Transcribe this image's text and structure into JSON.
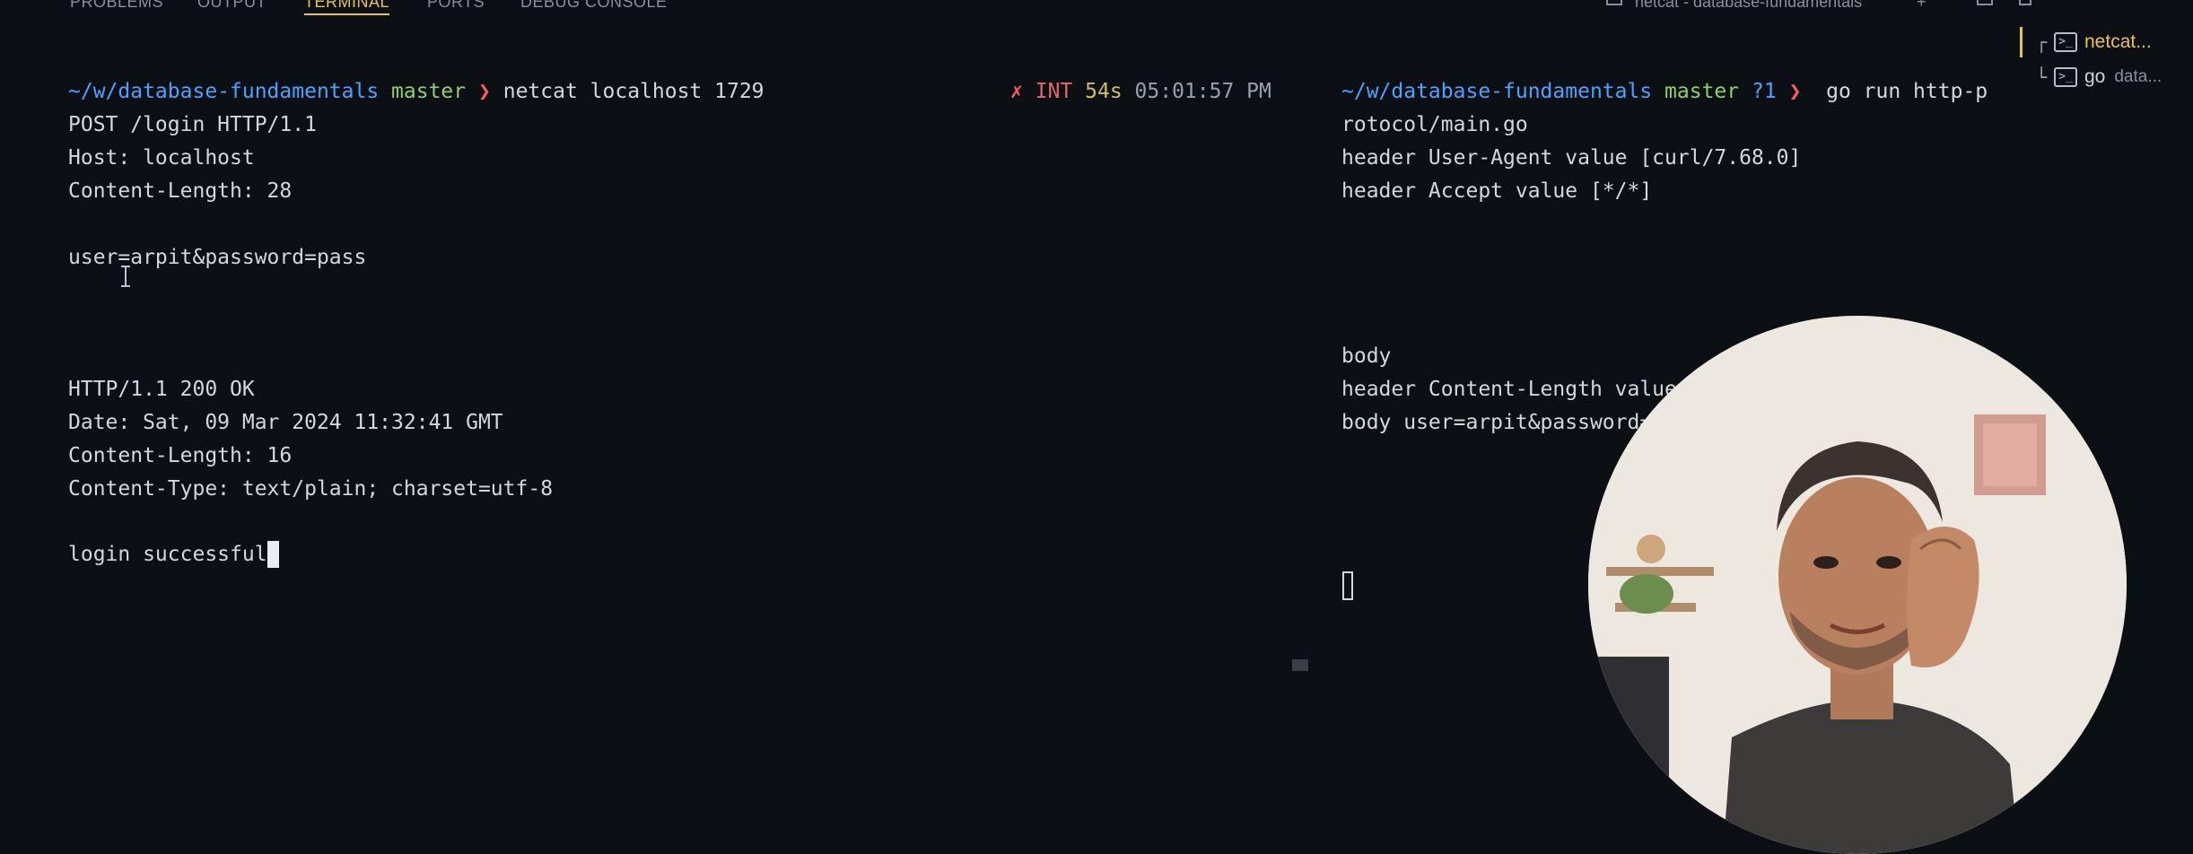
{
  "panel_tabs": [
    "PROBLEMS",
    "OUTPUT",
    "TERMINAL",
    "PORTS",
    "DEBUG CONSOLE"
  ],
  "active_tab": "TERMINAL",
  "top_right": {
    "terminal_title": "netcat - database-fundamentals",
    "plus": "+"
  },
  "terminal_list": [
    {
      "name": "netcat...",
      "sub": "",
      "active": true,
      "icon": "terminal-icon"
    },
    {
      "name": "go",
      "sub": "data...",
      "active": false,
      "icon": "terminal-icon"
    }
  ],
  "left_pane": {
    "prompt": {
      "path_prefix": "~/w/",
      "path_dir": "database-fundamentals",
      "branch": "master",
      "chevron": "❯",
      "command": "netcat localhost 1729",
      "status_x": "✗",
      "status_int": "INT",
      "duration": "54s",
      "time": "05:01:57 PM"
    },
    "request_lines": [
      "POST /login HTTP/1.1",
      "Host: localhost",
      "Content-Length: 28",
      "",
      "user=arpit&password=pass"
    ],
    "response_lines": [
      "HTTP/1.1 200 OK",
      "Date: Sat, 09 Mar 2024 11:32:41 GMT",
      "Content-Length: 16",
      "Content-Type: text/plain; charset=utf-8",
      "",
      "login successful"
    ]
  },
  "right_pane": {
    "prompt": {
      "path_prefix": "~/w/",
      "path_dir": "database-fundamentals",
      "branch": "master",
      "untracked": "?1",
      "chevron": "❯",
      "command": "go run http-p"
    },
    "lines": [
      "rotocol/main.go",
      "header User-Agent value [curl/7.68.0]",
      "header Accept value [*/*]",
      "",
      "",
      "",
      "",
      "body",
      "header Content-Length value",
      "body user=arpit&password="
    ]
  },
  "colors": {
    "background": "#0c0f14",
    "path": "#4aa3ff",
    "branch": "#8bd16a",
    "error": "#ff5c5c",
    "accent": "#e7c44a"
  }
}
